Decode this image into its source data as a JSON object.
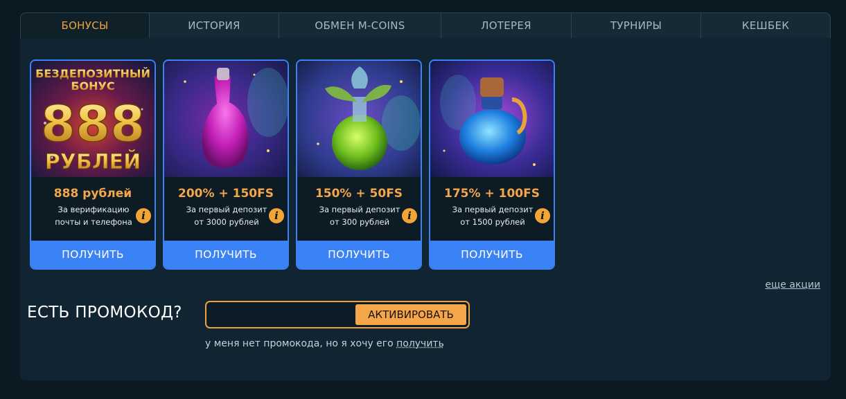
{
  "tabs": [
    {
      "label": "БОНУСЫ",
      "active": true
    },
    {
      "label": "ИСТОРИЯ",
      "active": false
    },
    {
      "label": "ОБМЕН M-COINS",
      "active": false
    },
    {
      "label": "ЛОТЕРЕЯ",
      "active": false
    },
    {
      "label": "ТУРНИРЫ",
      "active": false
    },
    {
      "label": "КЕШБЕК",
      "active": false
    }
  ],
  "cards": [
    {
      "image": "no-deposit-bonus-banner",
      "image_text": {
        "line1": "БЕЗДЕПОЗИТНЫЙ",
        "line2": "БОНУС",
        "amount": "888",
        "currency": "РУБЛЕЙ"
      },
      "title": "888 рублей",
      "desc1": "За верификацию",
      "desc2": "почты и телефона",
      "button": "ПОЛУЧИТЬ"
    },
    {
      "image": "purple-potion",
      "title": "200% + 150FS",
      "desc1": "За первый депозит",
      "desc2": "от 3000 рублей",
      "button": "ПОЛУЧИТЬ"
    },
    {
      "image": "green-potion",
      "title": "150% + 50FS",
      "desc1": "За первый депозит",
      "desc2": "от 300 рублей",
      "button": "ПОЛУЧИТЬ"
    },
    {
      "image": "blue-potion",
      "title": "175% + 100FS",
      "desc1": "За первый депозит",
      "desc2": "от 1500 рублей",
      "button": "ПОЛУЧИТЬ"
    }
  ],
  "more_link": "еще акции",
  "promo": {
    "label": "ЕСТЬ ПРОМОКОД?",
    "input_value": "",
    "button": "АКТИВИРОВАТЬ",
    "hint": "у меня нет промокода, но я хочу его",
    "hint_link": "получить"
  },
  "colors": {
    "accent": "#f0a23d",
    "button_blue": "#3b82f6",
    "background": "#0b1a22",
    "panel": "#102531"
  }
}
